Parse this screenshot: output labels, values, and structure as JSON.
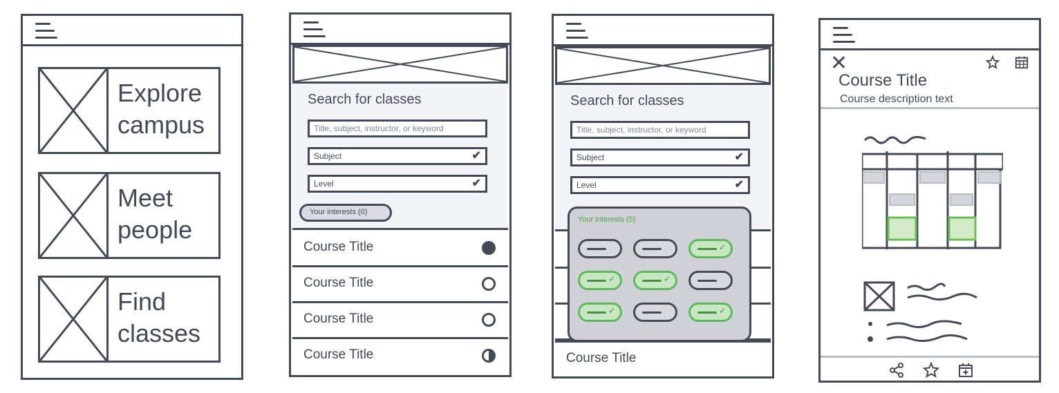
{
  "screens": {
    "home": {
      "tiles": [
        {
          "line1": "Explore",
          "line2": "campus"
        },
        {
          "line1": "Meet",
          "line2": "people"
        },
        {
          "line1": "Find",
          "line2": "classes"
        }
      ]
    },
    "search": {
      "heading": "Search for classes",
      "search_placeholder": "Title, subject, instructor, or keyword",
      "subject_label": "Subject",
      "level_label": "Level",
      "interests_label": "Your interests (0)",
      "courses": [
        "Course Title",
        "Course Title",
        "Course Title",
        "Course Title"
      ]
    },
    "interests": {
      "heading": "Search for classes",
      "search_placeholder": "Title, subject, instructor, or keyword",
      "subject_label": "Subject",
      "level_label": "Level",
      "interests_label": "Your interests (5)",
      "chips_selected": [
        false,
        false,
        true,
        true,
        true,
        false,
        true,
        false,
        true
      ],
      "course": "Course Title"
    },
    "detail": {
      "title": "Course Title",
      "description": "Course description text"
    }
  },
  "colors": {
    "stroke": "#434957",
    "accent_green": "#5cb85c",
    "panel_bg": "#f3f4f7"
  }
}
